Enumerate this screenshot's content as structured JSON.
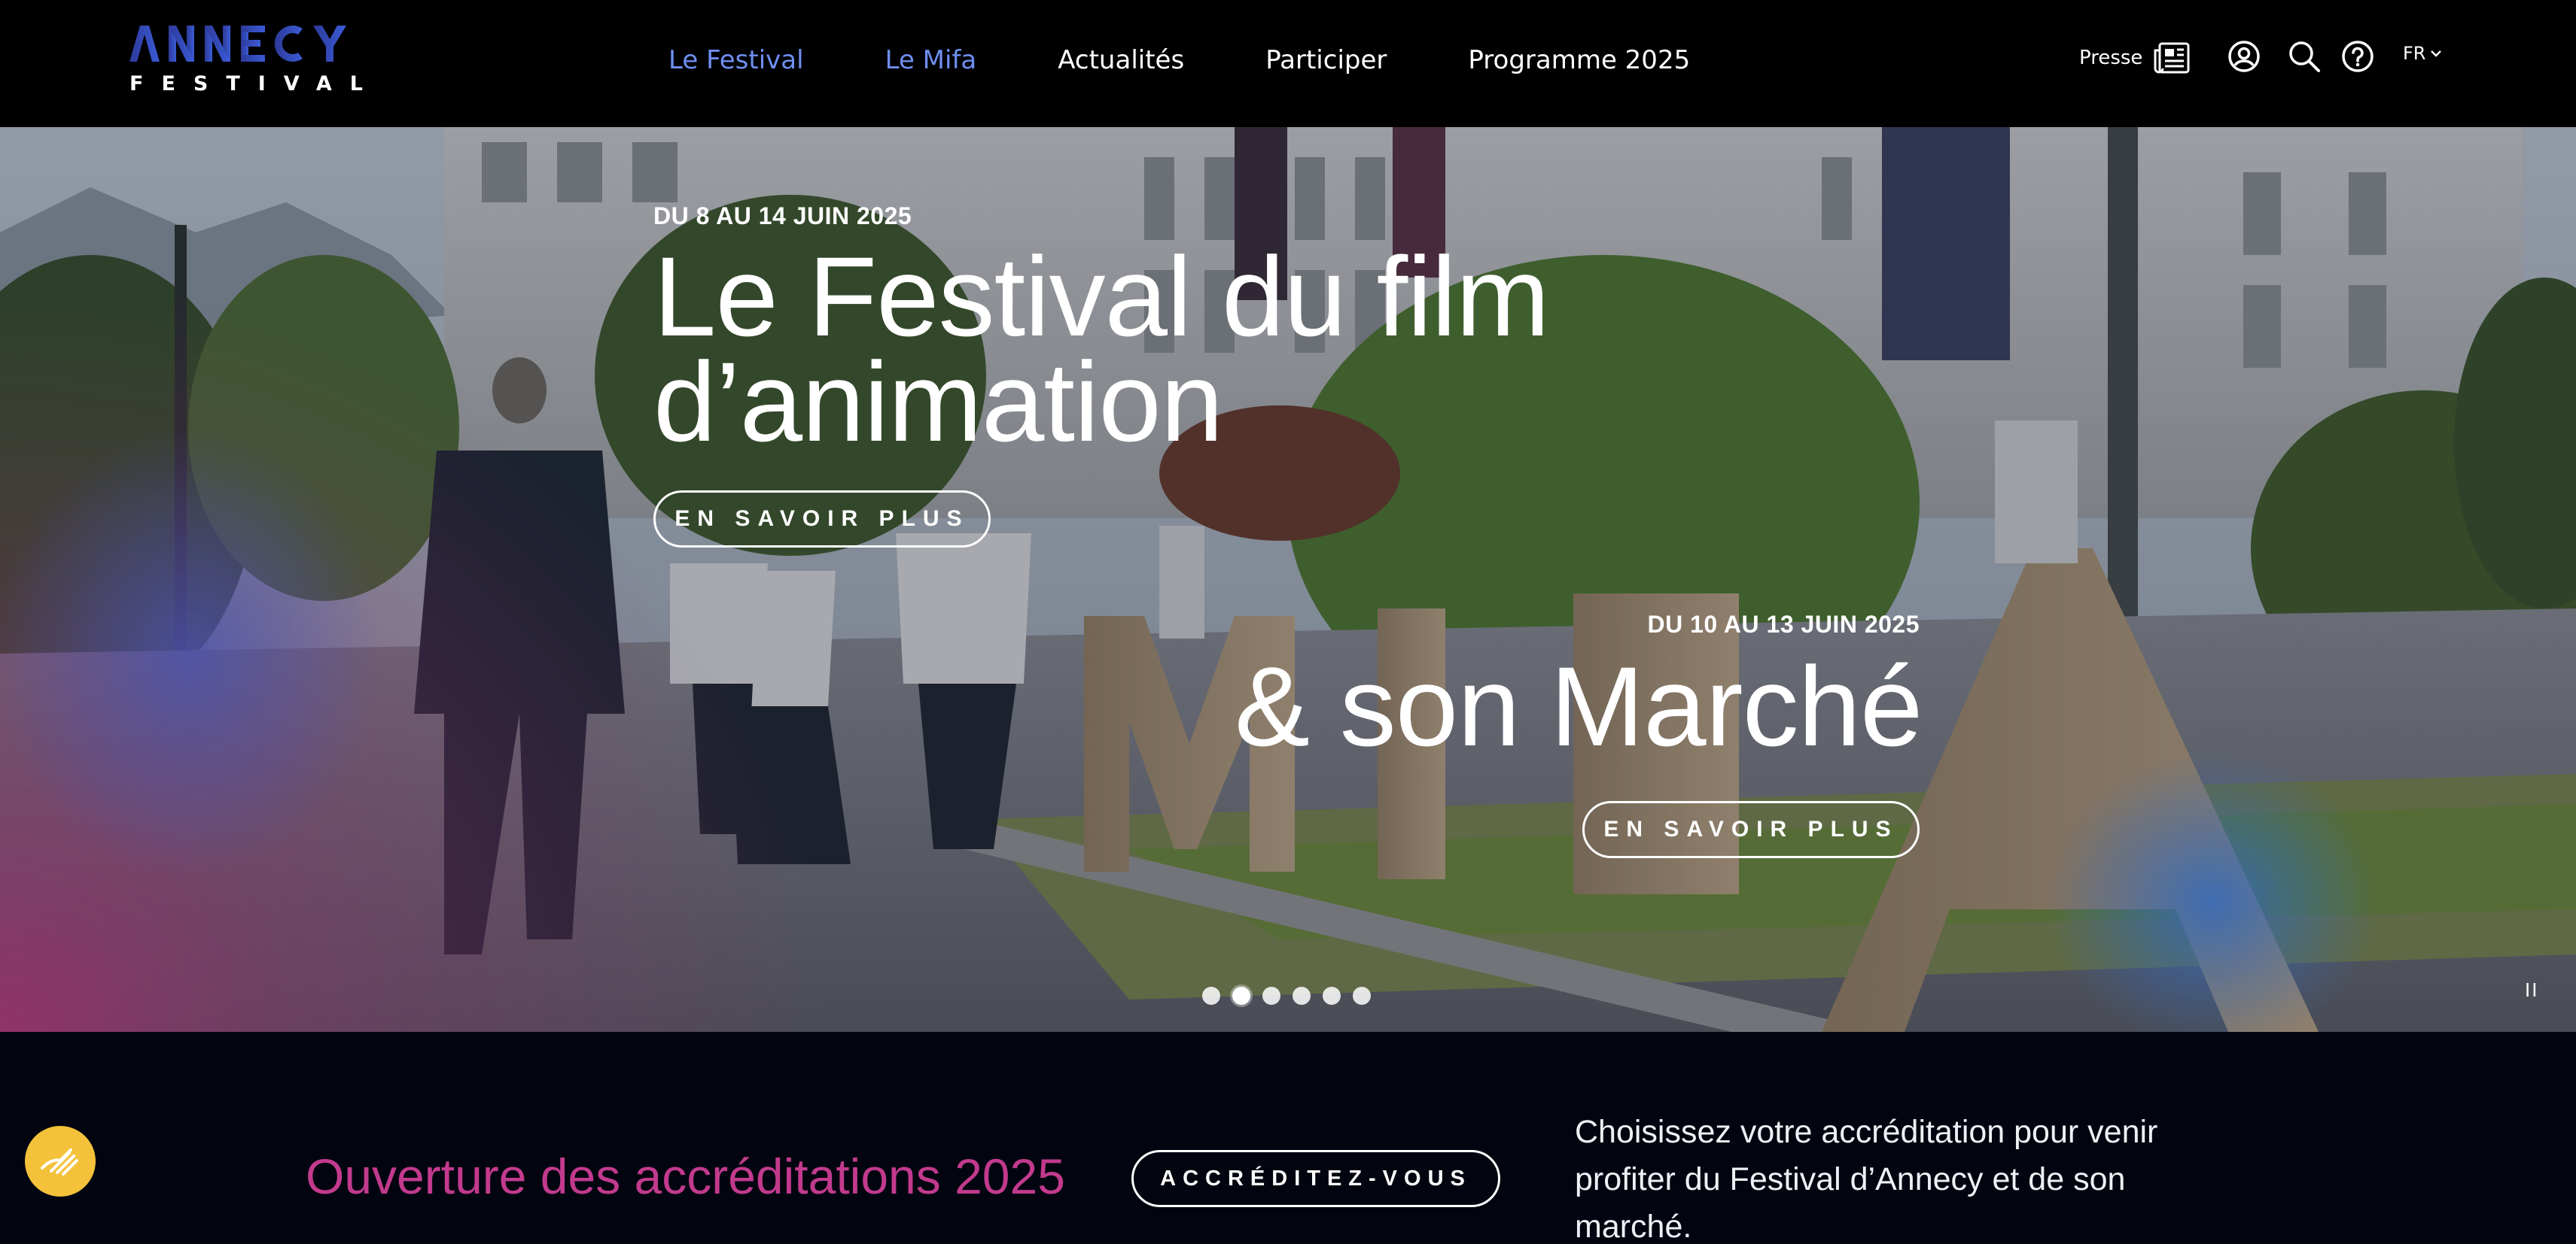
{
  "brand": {
    "logo_word": "ANNECY",
    "logo_sub": "FESTIVAL"
  },
  "nav": {
    "items": [
      {
        "label": "Le Festival"
      },
      {
        "label": "Le Mifa"
      },
      {
        "label": "Actualités"
      },
      {
        "label": "Participer"
      },
      {
        "label": "Programme 2025"
      }
    ],
    "accent_color": "#6f8ff2"
  },
  "header_tools": {
    "presse_label": "Presse",
    "press_icon": "newspaper-icon",
    "account_icon": "user-circle-icon",
    "search_icon": "search-icon",
    "help_icon": "help-circle-icon",
    "language": "FR",
    "language_icon": "chevron-down-icon"
  },
  "hero": {
    "slide1": {
      "date": "DU 8 AU 14 JUIN 2025",
      "title_line1": "Le Festival du film",
      "title_line2": "d’animation",
      "cta": "EN SAVOIR PLUS"
    },
    "slide2": {
      "date": "DU 10 AU 13 JUIN 2025",
      "title": "& son Marché",
      "cta": "EN SAVOIR PLUS"
    },
    "carousel": {
      "total": 6,
      "active_index": 1,
      "pause_icon": "pause-icon",
      "pause_label": "II"
    }
  },
  "band": {
    "title": "Ouverture des accréditations 2025",
    "button": "ACCRÉDITEZ-VOUS",
    "description": "Choisissez votre accréditation pour venir profiter du Festival d’Annecy et de son marché.",
    "title_color": "#c23a8d"
  },
  "accessibility": {
    "icon": "accessibility-hand-icon",
    "color": "#f4c23a"
  }
}
